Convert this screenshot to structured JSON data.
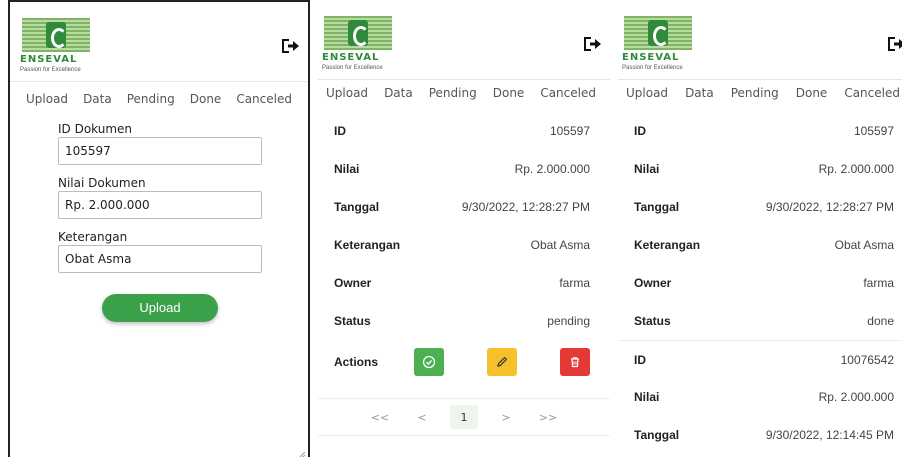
{
  "brand": {
    "name": "ENSEVAL",
    "tagline": "Passion for Excellence"
  },
  "tabs": [
    "Upload",
    "Data",
    "Pending",
    "Done",
    "Canceled"
  ],
  "form": {
    "id_label": "ID Dokumen",
    "id_value": "105597",
    "nilai_label": "Nilai Dokumen",
    "nilai_value": "Rp. 2.000.000",
    "ket_label": "Keterangan",
    "ket_value": "Obat Asma",
    "submit_label": "Upload"
  },
  "detail": {
    "rows": [
      {
        "label": "ID",
        "value": "105597"
      },
      {
        "label": "Nilai",
        "value": "Rp. 2.000.000"
      },
      {
        "label": "Tanggal",
        "value": "9/30/2022, 12:28:27 PM"
      },
      {
        "label": "Keterangan",
        "value": "Obat Asma"
      },
      {
        "label": "Owner",
        "value": "farma"
      },
      {
        "label": "Status",
        "value": "pending"
      }
    ],
    "actions_label": "Actions",
    "pager": {
      "first": "<<",
      "prev": "<",
      "current": "1",
      "next": ">",
      "last": ">>"
    }
  },
  "done": {
    "rows": [
      {
        "label": "ID",
        "value": "105597"
      },
      {
        "label": "Nilai",
        "value": "Rp. 2.000.000"
      },
      {
        "label": "Tanggal",
        "value": "9/30/2022, 12:28:27 PM"
      },
      {
        "label": "Keterangan",
        "value": "Obat Asma"
      },
      {
        "label": "Owner",
        "value": "farma"
      },
      {
        "label": "Status",
        "value": "done"
      },
      {
        "label": "ID",
        "value": "10076542"
      },
      {
        "label": "Nilai",
        "value": "Rp. 2.000.000"
      },
      {
        "label": "Tanggal",
        "value": "9/30/2022, 12:14:45 PM"
      }
    ]
  },
  "icons": {
    "logout": "logout-icon",
    "approve": "check-circle-icon",
    "edit": "pencil-icon",
    "delete": "trash-icon"
  },
  "colors": {
    "brand_green": "#2f8a3b",
    "upload_button": "#3aa14a",
    "approve": "#4caf50",
    "edit": "#f5c02a",
    "delete": "#e53935"
  }
}
